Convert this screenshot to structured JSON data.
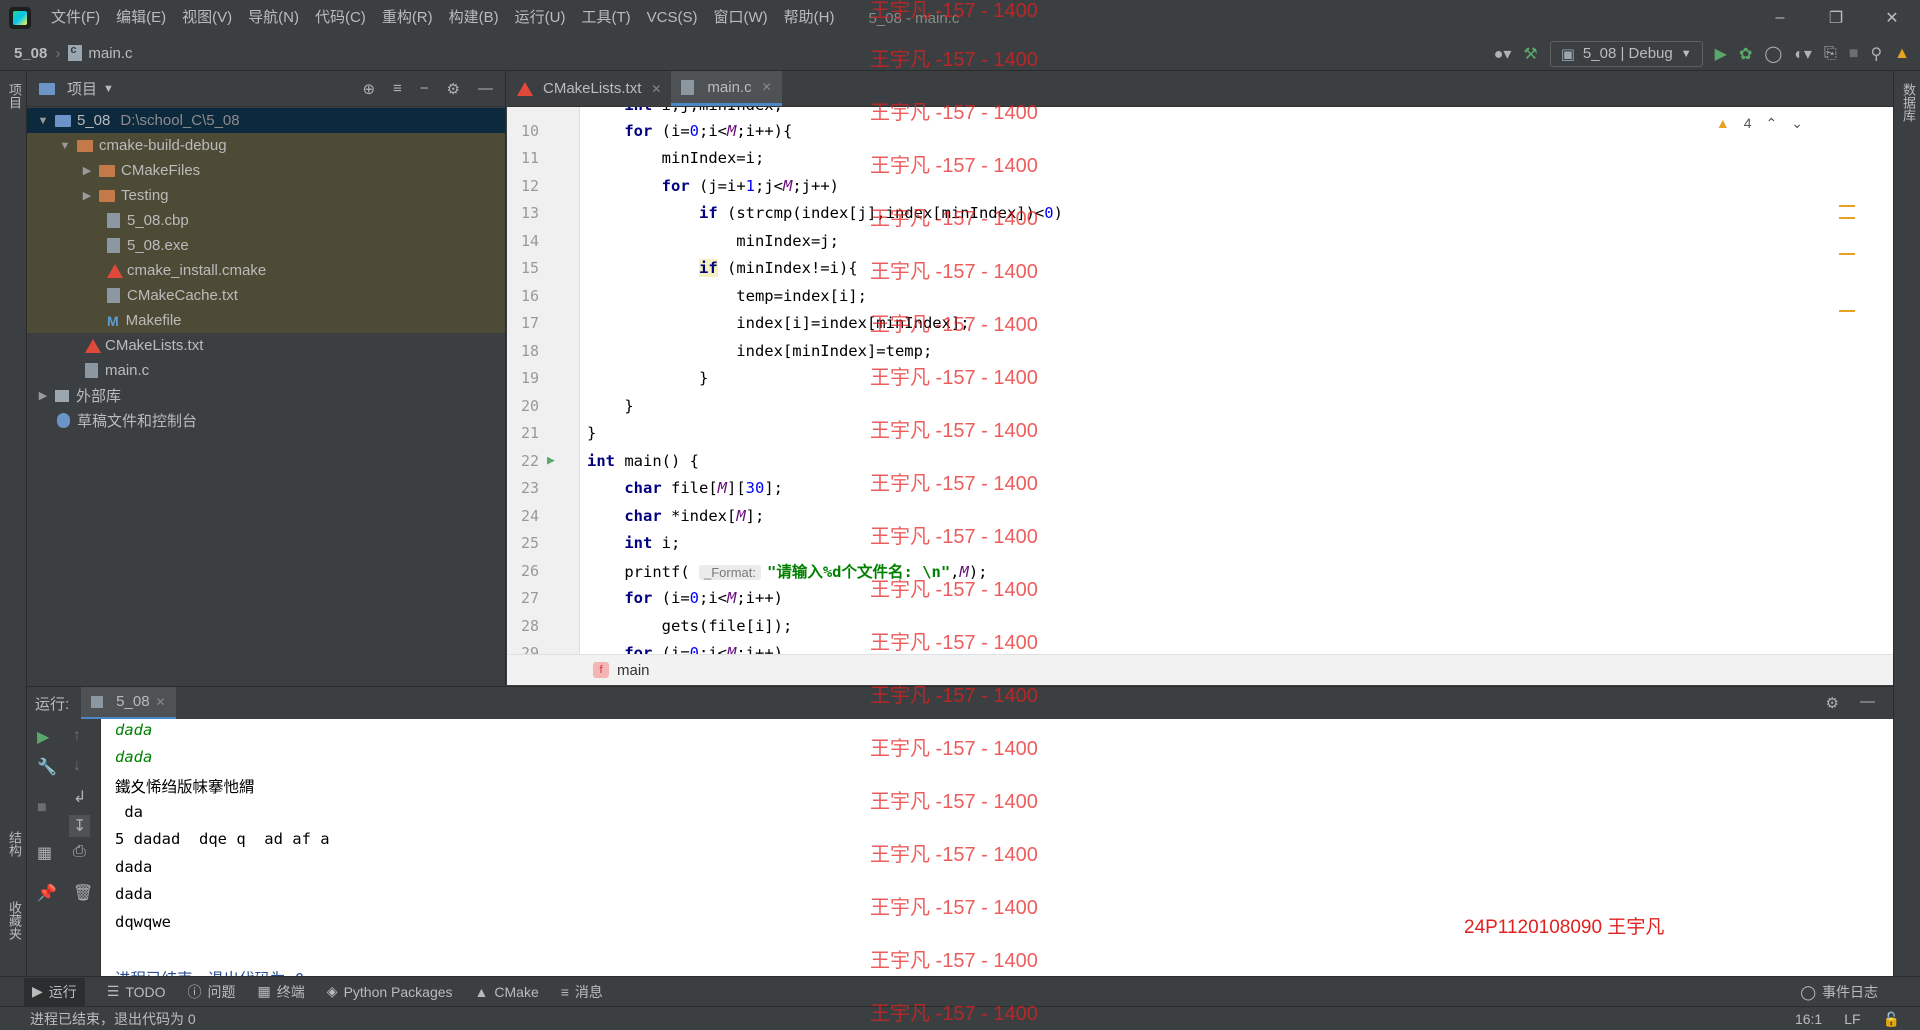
{
  "menu": [
    "文件(F)",
    "编辑(E)",
    "视图(V)",
    "导航(N)",
    "代码(C)",
    "重构(R)",
    "构建(B)",
    "运行(U)",
    "工具(T)",
    "VCS(S)",
    "窗口(W)",
    "帮助(H)"
  ],
  "window_title": "5_08 - main.c",
  "breadcrumb": {
    "project": "5_08",
    "file": "main.c"
  },
  "run_config": "5_08 | Debug",
  "left_strip": {
    "project_tab": "项目",
    "structure_tab": "结构",
    "favorites_tab": "收藏夹"
  },
  "right_strip": {
    "database_tab": "数据库"
  },
  "project_panel": {
    "title": "项目",
    "tree": [
      {
        "label": "5_08",
        "extra": "D:\\school_C\\5_08"
      },
      {
        "label": "cmake-build-debug"
      },
      {
        "label": "CMakeFiles"
      },
      {
        "label": "Testing"
      },
      {
        "label": "5_08.cbp"
      },
      {
        "label": "5_08.exe"
      },
      {
        "label": "cmake_install.cmake"
      },
      {
        "label": "CMakeCache.txt"
      },
      {
        "label": "Makefile"
      },
      {
        "label": "CMakeLists.txt"
      },
      {
        "label": "main.c"
      },
      {
        "label": "外部库"
      },
      {
        "label": "草稿文件和控制台"
      }
    ]
  },
  "editor": {
    "tabs": [
      "CMakeLists.txt",
      "main.c"
    ],
    "warnings": "4",
    "line_numbers": [
      "10",
      "11",
      "12",
      "13",
      "14",
      "15",
      "16",
      "17",
      "18",
      "19",
      "20",
      "21",
      "22",
      "23",
      "24",
      "25",
      "26",
      "27",
      "28",
      "29"
    ],
    "hint_label": "_Format:",
    "footer_function": "main"
  },
  "run_panel": {
    "label": "运行:",
    "tab": "5_08",
    "console": [
      "dada",
      "dada",
      "鐵夊悕绉版帓搴忚緭",
      " da",
      "5 dadad  dqe q  ad af a",
      "dada",
      "dada",
      "dqwqwe",
      "",
      "进程已结束，退出代码为 0"
    ]
  },
  "student_tag": "24P1120108090 王宇凡",
  "bottom_tools": [
    "运行",
    "TODO",
    "问题",
    "终端",
    "Python Packages",
    "CMake",
    "消息"
  ],
  "event_log": "事件日志",
  "status": {
    "message": "进程已结束，退出代码为 0",
    "position": "16:1",
    "line_sep": "LF"
  },
  "watermark": "王宇凡 -157 - 1400",
  "colors": {
    "keyword": "#000080",
    "string": "#008000",
    "number": "#0000ff",
    "accent": "#4a88c7",
    "watermark": "#e61e1e"
  }
}
